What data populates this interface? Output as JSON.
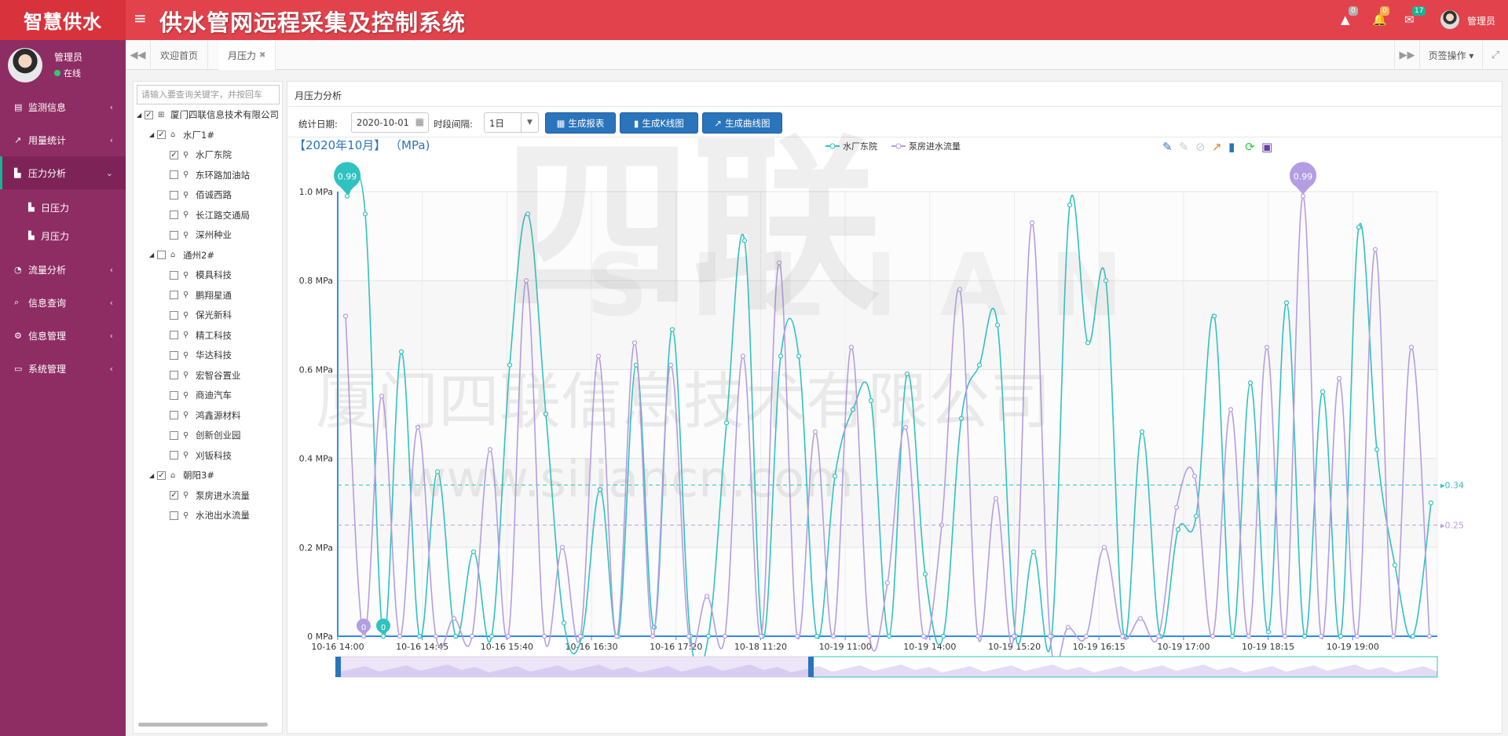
{
  "app": {
    "logo": "智慧供水",
    "menu_icon": "≡",
    "system_title": "供水管网远程采集及控制系统"
  },
  "topbar": {
    "icons": [
      {
        "name": "warning-icon",
        "glyph": "▲",
        "badge": "0",
        "color": "#b0b0b0"
      },
      {
        "name": "bell-icon",
        "glyph": "🔔",
        "badge": "0",
        "color": "#f8ac59"
      },
      {
        "name": "envelope-icon",
        "glyph": "✉",
        "badge": "17",
        "color": "#1ab394"
      }
    ],
    "user": "管理员"
  },
  "sidebar": {
    "user_name": "管理员",
    "status": "在线",
    "items": [
      {
        "label": "监测信息",
        "icon": "▤"
      },
      {
        "label": "用量统计",
        "icon": "↗"
      },
      {
        "label": "压力分析",
        "icon": "▙"
      },
      {
        "label": "流量分析",
        "icon": "◔"
      },
      {
        "label": "信息查询",
        "icon": "⌕"
      },
      {
        "label": "信息管理",
        "icon": "⚙"
      },
      {
        "label": "系统管理",
        "icon": "▭"
      }
    ],
    "subitems": [
      {
        "label": "日压力",
        "icon": "▙"
      },
      {
        "label": "月压力",
        "icon": "▙"
      }
    ]
  },
  "tabs": {
    "left_arrow": "◀◀",
    "right_arrow": "▶▶",
    "items": [
      {
        "label": "欢迎首页"
      },
      {
        "label": "月压力",
        "close": "✖"
      }
    ],
    "page_ops": "页签操作 ▾",
    "expand": "⤢"
  },
  "tree": {
    "search_placeholder": "请输入要查询关键字，并按回车",
    "root": "厦门四联信息技术有限公司",
    "groups": [
      {
        "label": "水厂1#",
        "checked": true,
        "children": [
          {
            "label": "水厂东院",
            "checked": true
          },
          {
            "label": "东环路加油站",
            "checked": false
          },
          {
            "label": "佰诚西路",
            "checked": false
          },
          {
            "label": "长江路交通局",
            "checked": false
          },
          {
            "label": "深州种业",
            "checked": false
          }
        ]
      },
      {
        "label": "通州2#",
        "checked": false,
        "children": [
          {
            "label": "模具科技",
            "checked": false
          },
          {
            "label": "鹏翔星通",
            "checked": false
          },
          {
            "label": "保光新科",
            "checked": false
          },
          {
            "label": "精工科技",
            "checked": false
          },
          {
            "label": "华达科技",
            "checked": false
          },
          {
            "label": "宏智谷置业",
            "checked": false
          },
          {
            "label": "商迪汽车",
            "checked": false
          },
          {
            "label": "鸿鑫源材料",
            "checked": false
          },
          {
            "label": "创新创业园",
            "checked": false
          },
          {
            "label": "刈钣科技",
            "checked": false
          }
        ]
      },
      {
        "label": "朝阳3#",
        "checked": true,
        "children": [
          {
            "label": "泵房进水流量",
            "checked": true
          },
          {
            "label": "水池出水流量",
            "checked": false
          }
        ]
      }
    ]
  },
  "panel": {
    "title": "月压力分析",
    "date_label": "统计日期:",
    "date_value": "2020-10-01",
    "interval_label": "时段间隔:",
    "interval_value": "1日",
    "buttons": [
      {
        "label": "生成报表",
        "icon": "▦"
      },
      {
        "label": "生成K线图",
        "icon": "▮"
      },
      {
        "label": "生成曲线图",
        "icon": "↗"
      }
    ]
  },
  "watermark": {
    "logo": "四联",
    "logo_en": "SILIAN",
    "company": "厦门四联信息技术有限公司",
    "url": "www.siliancn.com"
  },
  "chart_data": {
    "type": "line",
    "title": "【2020年10月】 （MPa)",
    "ylim": [
      0,
      1.0
    ],
    "yticks": [
      "0 MPa",
      "0.2 MPa",
      "0.4 MPa",
      "0.6 MPa",
      "0.8 MPa",
      "1.0 MPa"
    ],
    "xticks": [
      "10-16 14:00",
      "10-16 14:45",
      "10-16 15:40",
      "10-16 16:30",
      "10-16 17:20",
      "10-18 11:20",
      "10-19 11:00",
      "10-19 14:00",
      "10-19 15:20",
      "10-19 16:15",
      "10-19 17:00",
      "10-19 18:15",
      "10-19 19:00"
    ],
    "legend": "top-center",
    "series": [
      {
        "name": "水厂东院",
        "color": "#2ec2c1",
        "max": 0.99,
        "min": 0,
        "avg": 0.34,
        "values": [
          0.99,
          0.95,
          0,
          0.64,
          0,
          0.37,
          0,
          0.19,
          0,
          0.61,
          0.95,
          0.5,
          0.03,
          0,
          0.33,
          0,
          0.61,
          0.02,
          0.69,
          0,
          0,
          0.48,
          0.89,
          0,
          0.63,
          0.63,
          0,
          0.36,
          0.51,
          0.53,
          0,
          0.59,
          0.14,
          0,
          0.49,
          0.61,
          0.7,
          0,
          0.19,
          0,
          0.97,
          0.66,
          0.8,
          0,
          0.46,
          0,
          0.24,
          0.27,
          0.72,
          0,
          0.57,
          0.01,
          0.75,
          0,
          0.55,
          0,
          0.92,
          0.42,
          0.16,
          0,
          0.3
        ]
      },
      {
        "name": "泵房进水流量",
        "color": "#b49de3",
        "max": 0.99,
        "min": 0,
        "avg": 0.25,
        "values": [
          0.72,
          0,
          0.54,
          0,
          0.47,
          0,
          0.04,
          0,
          0.42,
          0,
          0.8,
          0,
          0.2,
          0,
          0.63,
          0,
          0.66,
          0,
          0.61,
          0,
          0.09,
          0,
          0.63,
          0,
          0.84,
          0,
          0.46,
          0,
          0.65,
          0,
          0.12,
          0.47,
          0,
          0.25,
          0.78,
          0,
          0.31,
          0,
          0.93,
          0,
          0.02,
          0,
          0.2,
          0,
          0.04,
          0,
          0.29,
          0.36,
          0,
          0.51,
          0,
          0.65,
          0,
          0.99,
          0,
          0.58,
          0,
          0.87,
          0,
          0.65,
          0
        ]
      }
    ],
    "max_label": "0.99",
    "min_label": "0",
    "avg_labels": [
      "0.34",
      "0.25"
    ]
  }
}
